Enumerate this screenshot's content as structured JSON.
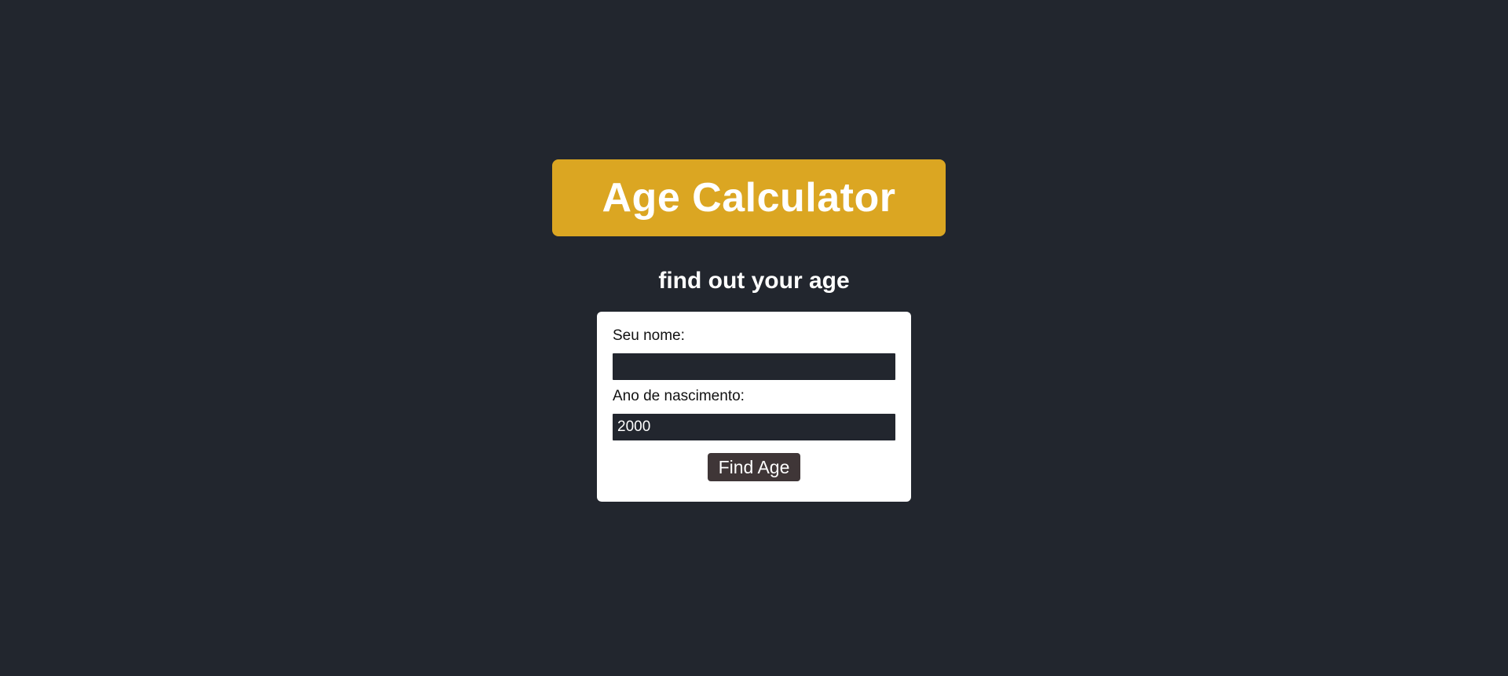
{
  "header": {
    "title": "Age Calculator",
    "subtitle": "find out your age"
  },
  "form": {
    "name_label": "Seu nome:",
    "name_value": "",
    "year_label": "Ano de nascimento:",
    "year_value": "2000",
    "submit_label": "Find Age"
  },
  "colors": {
    "background": "#22262e",
    "banner": "#dba622",
    "card": "#ffffff",
    "input": "#22262e",
    "button": "#3f3637"
  }
}
